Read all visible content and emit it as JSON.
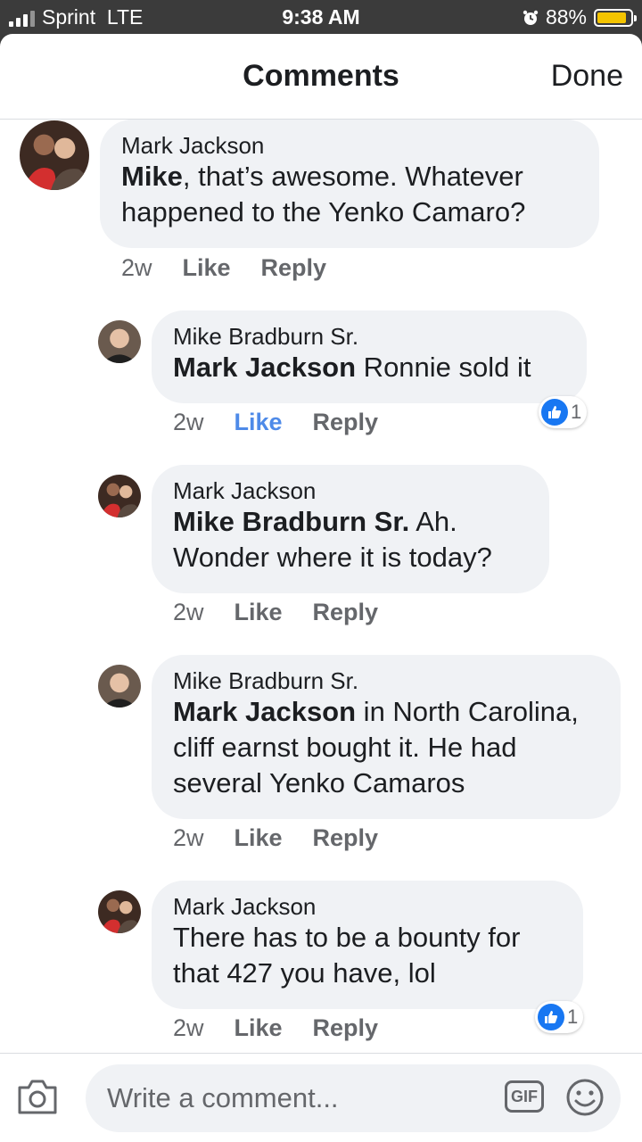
{
  "status_bar": {
    "carrier": "Sprint",
    "network": "LTE",
    "time": "9:38 AM",
    "battery": "88%",
    "battery_level": 0.88,
    "icons": [
      "signal-icon",
      "alarm-icon",
      "battery-icon"
    ]
  },
  "header": {
    "title": "Comments",
    "done_label": "Done"
  },
  "comments": [
    {
      "author": "Mark Jackson",
      "mention": "Mike",
      "text": ", that’s awesome.  Whatever happened to the Yenko Camaro?",
      "time": "2w",
      "like_label": "Like",
      "reply_label": "Reply",
      "liked": false
    },
    {
      "author": "Mike Bradburn Sr.",
      "mention": "Mark Jackson",
      "text": " Ronnie sold it",
      "time": "2w",
      "like_label": "Like",
      "reply_label": "Reply",
      "liked": true,
      "reaction_count": "1"
    },
    {
      "author": "Mark Jackson",
      "mention": "Mike Bradburn Sr.",
      "text": " Ah. Wonder where it is today?",
      "time": "2w",
      "like_label": "Like",
      "reply_label": "Reply",
      "liked": false
    },
    {
      "author": "Mike Bradburn Sr.",
      "mention": "Mark Jackson",
      "text": " in North Carolina, cliff earnst bought it. He had several Yenko Camaros",
      "time": "2w",
      "like_label": "Like",
      "reply_label": "Reply",
      "liked": false
    },
    {
      "author": "Mark Jackson",
      "mention": "",
      "text": "There has to be a bounty for that 427 you have, lol",
      "time": "2w",
      "like_label": "Like",
      "reply_label": "Reply",
      "liked": false,
      "reaction_count": "1"
    }
  ],
  "composer": {
    "placeholder": "Write a comment...",
    "gif_label": "GIF",
    "icons": [
      "camera-icon",
      "gif-icon",
      "emoji-icon"
    ]
  },
  "colors": {
    "like_active": "#4e8ae8",
    "reaction_blue": "#1877f2",
    "bubble": "#f0f2f5",
    "muted_text": "#65676b",
    "battery": "#f4c400"
  }
}
